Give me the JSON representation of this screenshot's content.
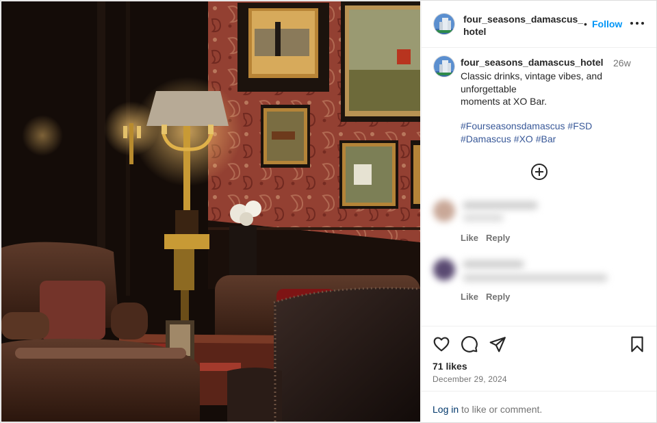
{
  "post": {
    "header": {
      "username": "four_seasons_damascus_hotel",
      "separator": "•",
      "follow_label": "Follow"
    },
    "caption": {
      "username": "four_seasons_damascus_hotel",
      "time_ago": "26w",
      "lines": [
        "Classic drinks, vintage vibes, and",
        "unforgettable",
        "moments at XO Bar."
      ],
      "hashtag_lines": [
        "#Fourseasonsdamascus #FSD",
        "#Damascus #XO #Bar"
      ]
    },
    "comments": [
      {
        "like_label": "Like",
        "reply_label": "Reply"
      },
      {
        "like_label": "Like",
        "reply_label": "Reply"
      }
    ],
    "actions": {
      "icons": [
        "heart-icon",
        "comment-icon",
        "share-icon",
        "bookmark-icon"
      ]
    },
    "likes": "71 likes",
    "date": "December 29, 2024",
    "login_prompt": {
      "link_label": "Log in",
      "rest": " to like or comment."
    }
  },
  "colors": {
    "follow": "#0095f6",
    "hashtag": "#385898",
    "secondary_text": "#737373",
    "login_link": "#00376b"
  }
}
